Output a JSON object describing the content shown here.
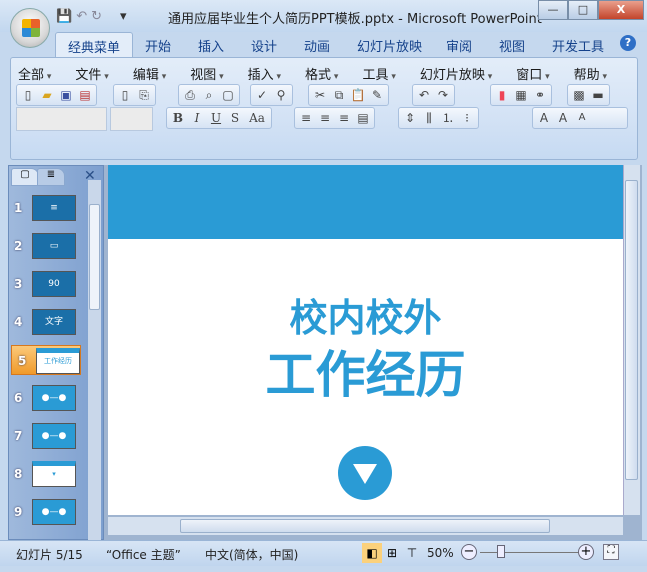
{
  "window": {
    "title": "通用应届毕业生个人简历PPT模板.pptx - Microsoft PowerPoint",
    "minimize": "—",
    "maximize": "□",
    "close": "X"
  },
  "qat": {
    "save": "💾",
    "undo": "↶",
    "redo": "↻",
    "customize": "▾"
  },
  "tabs": [
    "经典菜单",
    "开始",
    "插入",
    "设计",
    "动画",
    "幻灯片放映",
    "审阅",
    "视图",
    "开发工具"
  ],
  "help": "?",
  "menus": [
    "全部",
    "文件",
    "编辑",
    "视图",
    "插入",
    "格式",
    "工具",
    "幻灯片放映",
    "窗口",
    "帮助"
  ],
  "format_buttons": {
    "bold": "B",
    "italic": "I",
    "underline": "U",
    "shadow": "S",
    "case": "Aa"
  },
  "panel": {
    "close": "✕",
    "slides": [
      {
        "num": "1",
        "thumb": "≡"
      },
      {
        "num": "2",
        "thumb": "▭"
      },
      {
        "num": "3",
        "thumb": "90"
      },
      {
        "num": "4",
        "thumb": "文字"
      },
      {
        "num": "5",
        "thumb": "工作经历"
      },
      {
        "num": "6",
        "thumb": "●—●"
      },
      {
        "num": "7",
        "thumb": "●—●"
      },
      {
        "num": "8",
        "thumb": "▾"
      },
      {
        "num": "9",
        "thumb": "●—●"
      }
    ]
  },
  "slide": {
    "subtitle": "校内校外",
    "title": "工作经历"
  },
  "status": {
    "slide": "幻灯片 5/15",
    "theme": "“Office 主题”",
    "language": "中文(简体，中国)",
    "zoom": "50%"
  },
  "colors": {
    "accent": "#2a9bd5",
    "selected": "#f09a2a"
  }
}
